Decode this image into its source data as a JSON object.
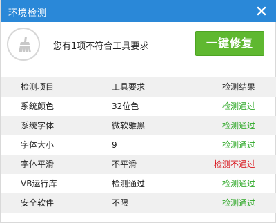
{
  "window": {
    "title": "环境检测"
  },
  "header": {
    "summary": "您有1项不符合工具要求",
    "fix_label": "一键修复"
  },
  "table": {
    "columns": [
      "检测项目",
      "工具要求",
      "检测结果"
    ],
    "rows": [
      {
        "item": "系统颜色",
        "requirement": "32位色",
        "result": "检测通过",
        "status": "pass"
      },
      {
        "item": "系统字体",
        "requirement": "微软雅黑",
        "result": "检测通过",
        "status": "pass"
      },
      {
        "item": "字体大小",
        "requirement": "9",
        "result": "检测通过",
        "status": "pass"
      },
      {
        "item": "字体平滑",
        "requirement": "不平滑",
        "result": "检测不通过",
        "status": "fail"
      },
      {
        "item": "VB运行库",
        "requirement": "检测通过",
        "result": "检测通过",
        "status": "pass"
      },
      {
        "item": "安全软件",
        "requirement": "不限",
        "result": "检测通过",
        "status": "pass"
      }
    ]
  },
  "colors": {
    "titlebar": "#2a88d8",
    "button": "#5fb830",
    "pass": "#2da826",
    "fail": "#d8141c"
  }
}
